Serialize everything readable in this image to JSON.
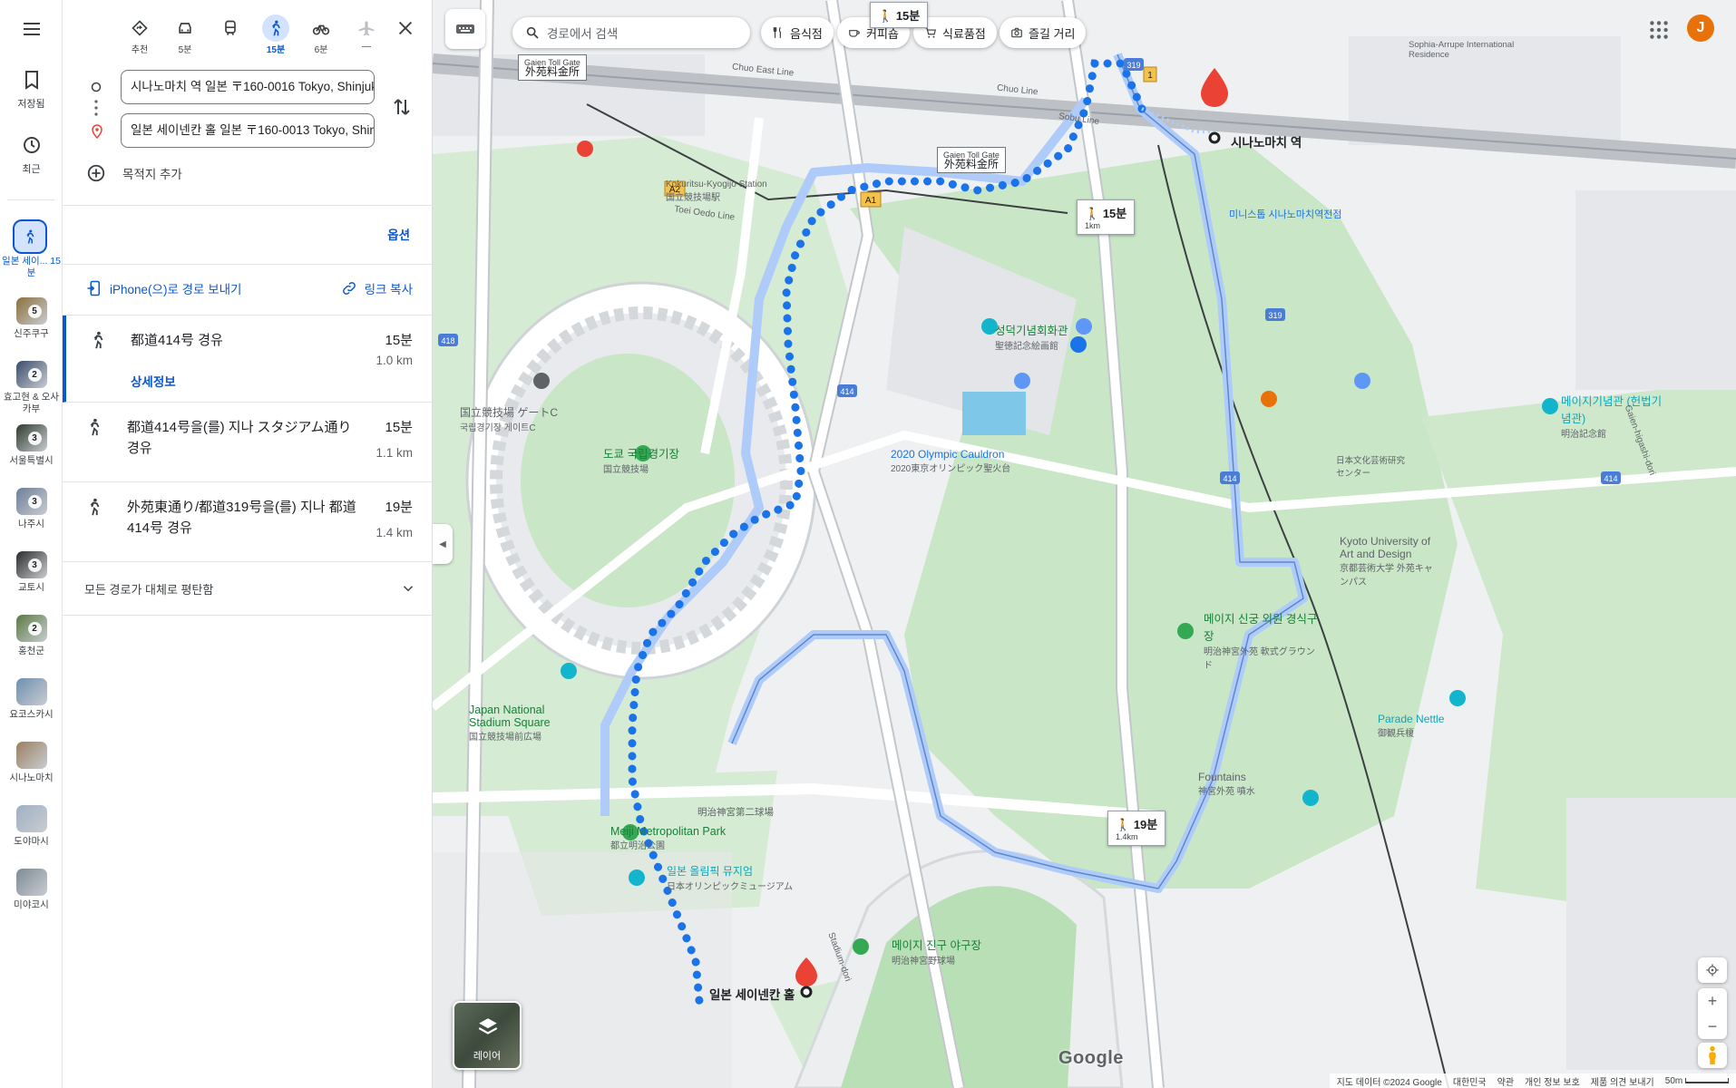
{
  "rail": {
    "menu_icon": "menu-icon",
    "saved_label": "저장됨",
    "recent_label": "최근",
    "active_label": "일본 세이... 15분",
    "recents": [
      {
        "label": "신주쿠구",
        "count": "5"
      },
      {
        "label": "효고현 & 오사카부",
        "count": "2"
      },
      {
        "label": "서울특별시",
        "count": "3"
      },
      {
        "label": "나주시",
        "count": "3"
      },
      {
        "label": "교토시",
        "count": "3"
      },
      {
        "label": "홍천군",
        "count": "2"
      },
      {
        "label": "요코스카시",
        "count": ""
      },
      {
        "label": "시나노마치",
        "count": ""
      },
      {
        "label": "도야마시",
        "count": ""
      },
      {
        "label": "미야코시",
        "count": ""
      }
    ]
  },
  "modes": [
    {
      "name": "recommended",
      "label": "추천",
      "active": false
    },
    {
      "name": "car",
      "label": "5분",
      "active": false
    },
    {
      "name": "transit",
      "label": "",
      "active": false
    },
    {
      "name": "walk",
      "label": "15분",
      "active": true
    },
    {
      "name": "bike",
      "label": "6분",
      "active": false
    },
    {
      "name": "flight",
      "label": "—",
      "active": false
    }
  ],
  "waypoints": {
    "origin": "시나노마치 역 일본 〒160-0016 Tokyo, Shinjuku City",
    "destination": "일본 세이넨칸 홀 일본 〒160-0013 Tokyo, Shinjuku"
  },
  "add_destination": "목적지 추가",
  "options_label": "옵션",
  "send_to_phone": "iPhone(으)로 경로 보내기",
  "copy_link": "링크 복사",
  "routes": [
    {
      "title": "都道414号 경유",
      "time": "15분",
      "distance": "1.0 km",
      "detail": "상세정보"
    },
    {
      "title": "都道414号을(를) 지나 スタジアム通り 경유",
      "time": "15분",
      "distance": "1.1 km",
      "detail": ""
    },
    {
      "title": "外苑東通り/都道319号을(를) 지나 都道414号 경유",
      "time": "19분",
      "distance": "1.4 km",
      "detail": ""
    }
  ],
  "route_note": "모든 경로가 대체로 평탄함",
  "map": {
    "search_placeholder": "경로에서 검색",
    "chips": [
      "음식점",
      "커피숍",
      "식료품점",
      "즐길 거리"
    ],
    "user_initial": "J",
    "layers_label": "레이어",
    "toll_gate_1": {
      "en": "Gaien Toll Gate",
      "jp": "外苑料金所"
    },
    "toll_gate_2": {
      "en": "Gaien Toll Gate",
      "jp": "外苑料金所"
    },
    "top_walk_badge": "15분",
    "route_badge_main": {
      "time": "15분",
      "dist": "1km"
    },
    "route_badge_alt": {
      "time": "19분",
      "dist": "1.4km"
    },
    "origin_label": "시나노마치 역",
    "destination_label": "일본 세이넨칸 홀",
    "places": {
      "stadium": "도쿄 국립경기장",
      "stadium_sub": "国立競技場",
      "seitoku": "성덕기념회화관",
      "seitoku_sub": "聖徳記念絵画館",
      "olympic": "2020 Olympic Cauldron",
      "olympic_sub": "2020東京オリンピック聖火台",
      "meiji_hall": "메이지기념관 (헌법기념관)",
      "meiji_hall_sub": "明治記念館",
      "kyoto_univ": "Kyoto University of Art and Design",
      "kyoto_univ_sub": "京都芸術大学 外苑キャンパス",
      "gaien_field": "메이지 신궁 외원 경식구장",
      "gaien_field_sub": "明治神宮外苑 軟式グラウンド",
      "parade": "Parade Nettle",
      "parade_sub": "御観兵榎",
      "fountains": "Fountains",
      "fountains_sub": "神宮外苑 噴水",
      "stadium_square": "Japan National Stadium Square",
      "stadium_square_sub": "国立競技場前広場",
      "meiji_park": "Meiji Metropolitan Park",
      "meiji_park_sub": "都立明治公園",
      "olympic_museum": "일본 올림픽 뮤지엄",
      "olympic_museum_sub": "日本オリンピックミュージアム",
      "jingu_stadium": "메이지 진구 야구장",
      "jingu_stadium_sub": "明治神宮野球場",
      "gate": "国立競技場 ゲートC",
      "gate_sub": "국립경기장 게이트C",
      "kokuritsu_station": "Kokuritsu-Kyogijo Station",
      "kokuritsu_station_sub": "国立競技場駅",
      "mini_stop": "미니스톱 시나노마치역전점",
      "second_field": "明治神宮第二球場",
      "sophia": "Sophia-Arrupe International Residence",
      "japan_art": "日本文化芸術研究センター",
      "chuo_east": "Chuo East Line",
      "chuo_line": "Chuo Line",
      "sobu_line": "Sobu Line",
      "tokyo_kyogijo": "Toei Oedo Line",
      "stadium_dori": "Stadium-dori",
      "gaien_east": "Gaien-higashi-dori"
    },
    "road_numbers": [
      "319",
      "414",
      "418",
      "4"
    ],
    "station_marks": [
      "A1",
      "A2",
      "1"
    ],
    "copyright": "지도 데이터 ©2024 Google",
    "country": "대한민국",
    "terms": "약관",
    "privacy": "개인 정보 보호",
    "feedback": "제품 의견 보내기",
    "scale": "50m",
    "google_logo": "Google"
  },
  "colors": {
    "route_blue": "#1a73e8",
    "route_alt": "#aecbfa",
    "park_green": "#c8e8c8",
    "accent": "#0b57d0",
    "pin_red": "#ea4335",
    "user_orange": "#e8710a"
  }
}
